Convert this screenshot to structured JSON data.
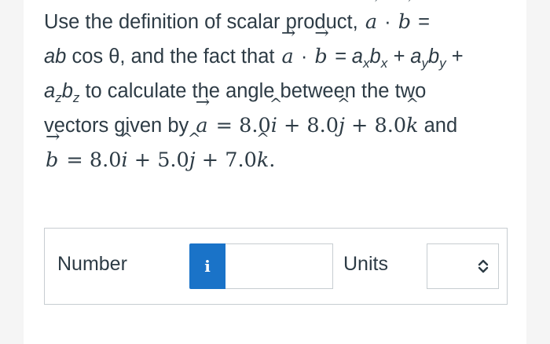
{
  "question": {
    "l1_text": "Use the definition of scalar product, ",
    "vec_a": "a",
    "vec_b": "b",
    "dot": " · ",
    "equals": " =",
    "l2_ab": "ab",
    "l2_cos": " cos θ, and the fact that ",
    "l2_eq": " = a",
    "l2_rest_x": "b",
    "l2_plus1": " + a",
    "l2_rest_y": "b",
    "l2_plus2": " +",
    "sub_x": "x",
    "sub_y": "y",
    "sub_z": "z",
    "l3_a": "a",
    "l3_b": "b",
    "l3_text": " to calculate the angle between the two",
    "l4_text": "vectors given by ",
    "l4_expr1": " = 8.0",
    "l4_expr2": " + 8.0",
    "l4_expr3": " + 8.0",
    "l4_and": " and",
    "l5_expr1": " = 8.0",
    "l5_expr2": " + 5.0",
    "l5_expr3": " + 7.0",
    "l5_end": ".",
    "unit_i": "i",
    "unit_j": "j",
    "unit_k": "k"
  },
  "answer": {
    "number_label": "Number",
    "info_label": "i",
    "number_value": "",
    "units_label": "Units",
    "units_value": ""
  },
  "colors": {
    "info_button": "#1a73c8",
    "border": "#c7cdd1"
  }
}
